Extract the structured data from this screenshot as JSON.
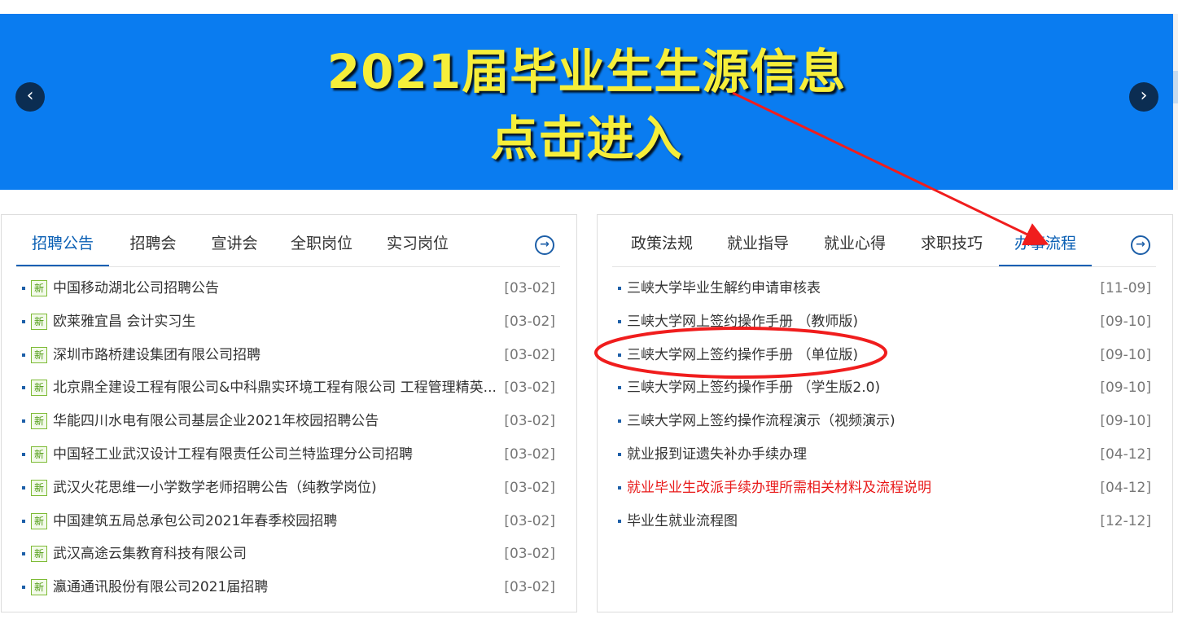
{
  "banner": {
    "line1": "2021届毕业生生源信息",
    "line2": "点击进入",
    "prev_icon": "‹",
    "next_icon": "›",
    "bg_color": "#0a7cf0",
    "text_color": "#f6ee3a"
  },
  "left_panel": {
    "tabs": [
      {
        "label": "招聘公告",
        "active": true
      },
      {
        "label": "招聘会",
        "active": false
      },
      {
        "label": "宣讲会",
        "active": false
      },
      {
        "label": "全职岗位",
        "active": false
      },
      {
        "label": "实习岗位",
        "active": false
      }
    ],
    "more_icon": "→",
    "new_tag": "新",
    "items": [
      {
        "title": "中国移动湖北公司招聘公告",
        "date": "[03-02]"
      },
      {
        "title": "欧莱雅宜昌 会计实习生",
        "date": "[03-02]"
      },
      {
        "title": "深圳市路桥建设集团有限公司招聘",
        "date": "[03-02]"
      },
      {
        "title": "北京鼎全建设工程有限公司&中科鼎实环境工程有限公司 工程管理精英...",
        "date": "[03-02]"
      },
      {
        "title": "华能四川水电有限公司基层企业2021年校园招聘公告",
        "date": "[03-02]"
      },
      {
        "title": "中国轻工业武汉设计工程有限责任公司兰特监理分公司招聘",
        "date": "[03-02]"
      },
      {
        "title": "武汉火花思维一小学数学老师招聘公告（纯教学岗位)",
        "date": "[03-02]"
      },
      {
        "title": "中国建筑五局总承包公司2021年春季校园招聘",
        "date": "[03-02]"
      },
      {
        "title": "武汉高途云集教育科技有限公司",
        "date": "[03-02]"
      },
      {
        "title": "瀛通通讯股份有限公司2021届招聘",
        "date": "[03-02]"
      }
    ]
  },
  "right_panel": {
    "tabs": [
      {
        "label": "政策法规",
        "active": false
      },
      {
        "label": "就业指导",
        "active": false
      },
      {
        "label": "就业心得",
        "active": false
      },
      {
        "label": "求职技巧",
        "active": false
      },
      {
        "label": "办事流程",
        "active": true
      }
    ],
    "more_icon": "→",
    "items": [
      {
        "title": "三峡大学毕业生解约申请审核表",
        "date": "[11-09]",
        "highlight": false
      },
      {
        "title": "三峡大学网上签约操作手册 （教师版)",
        "date": "[09-10]",
        "highlight": false
      },
      {
        "title": "三峡大学网上签约操作手册 （单位版)",
        "date": "[09-10]",
        "highlight": false
      },
      {
        "title": "三峡大学网上签约操作手册 （学生版2.0)",
        "date": "[09-10]",
        "highlight": false
      },
      {
        "title": "三峡大学网上签约操作流程演示（视频演示)",
        "date": "[09-10]",
        "highlight": false
      },
      {
        "title": "就业报到证遗失补办手续办理",
        "date": "[04-12]",
        "highlight": false
      },
      {
        "title": "就业毕业生改派手续办理所需相关材料及流程说明",
        "date": "[04-12]",
        "highlight": true
      },
      {
        "title": "毕业生就业流程图",
        "date": "[12-12]",
        "highlight": false
      }
    ]
  },
  "colors": {
    "accent": "#0a5fb4",
    "highlight_red": "#e81818",
    "annotation_red": "#f01d1d"
  }
}
